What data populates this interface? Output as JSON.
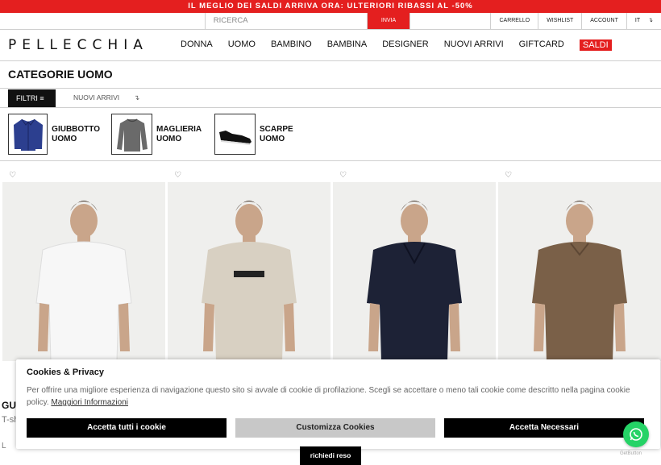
{
  "promo": "IL MEGLIO DEI SALDI ARRIVA ORA: ULTERIORI RIBASSI AL -50%",
  "topbar": {
    "search_placeholder": "RICERCA",
    "submit": "INVIA",
    "cart": "CARRELLO",
    "wishlist": "WISHLIST",
    "account": "ACCOUNT",
    "lang": "IT",
    "lang_arrow": "↴"
  },
  "header": {
    "logo": "PELLECCHIA",
    "nav": [
      "DONNA",
      "UOMO",
      "BAMBINO",
      "BAMBINA",
      "DESIGNER",
      "NUOVI ARRIVI",
      "GIFTCARD",
      "SALDI"
    ]
  },
  "page_title": "CATEGORIE UOMO",
  "filterbar": {
    "filters": "FILTRI",
    "filter_icon": "≡",
    "sort_label": "NUOVI ARRIVI",
    "sort_arrow": "↴"
  },
  "categories": [
    {
      "line1": "GIUBBOTTO",
      "line2": "UOMO",
      "icon": "jacket-icon"
    },
    {
      "line1": "MAGLIERIA",
      "line2": "UOMO",
      "icon": "sweater-icon"
    },
    {
      "line1": "SCARPE",
      "line2": "UOMO",
      "icon": "sneaker-icon"
    }
  ],
  "products": [
    {
      "shirt_color": "#f7f7f7",
      "heart": "♡"
    },
    {
      "shirt_color": "#d8d0c2",
      "heart": "♡"
    },
    {
      "shirt_color": "#1d2236",
      "heart": "♡"
    },
    {
      "shirt_color": "#7a6048",
      "heart": "♡"
    }
  ],
  "product_info": {
    "name": "GU",
    "sub": "T-sh",
    "size": "L"
  },
  "cookie": {
    "title": "Cookies & Privacy",
    "text": "Per offrire una migliore esperienza di navigazione questo sito si avvale di cookie di profilazione. Scegli se accettare o meno tali cookie come descritto nella pagina cookie policy.",
    "link": "Maggiori Informazioni",
    "accept_all": "Accetta tutti i cookie",
    "customize": "Customizza Cookies",
    "accept_necessary": "Accetta Necessari"
  },
  "request_return": "richiedi reso",
  "getbutton": "GetButton",
  "colors": {
    "accent_red": "#e41f1f",
    "whatsapp": "#25d366"
  }
}
